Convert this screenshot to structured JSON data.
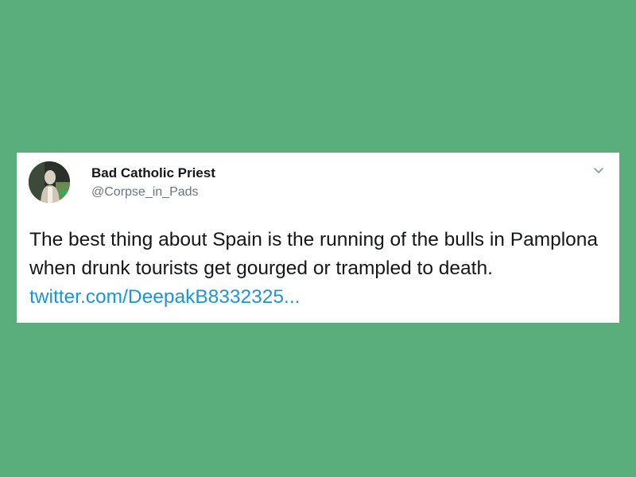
{
  "colors": {
    "background": "#5aae7b",
    "card": "#ffffff",
    "name": "#14171a",
    "handle": "#657786",
    "link": "#1b95e0"
  },
  "tweet": {
    "display_name": "Bad Catholic Priest",
    "handle": "@Corpse_in_Pads",
    "avatar_icon": "profile-photo",
    "menu_icon": "chevron-down-icon",
    "text": "The best thing about Spain is the running of the bulls in Pamplona when drunk tourists get gourged or trampled to death.",
    "link_text": "twitter.com/DeepakB8332325..."
  }
}
